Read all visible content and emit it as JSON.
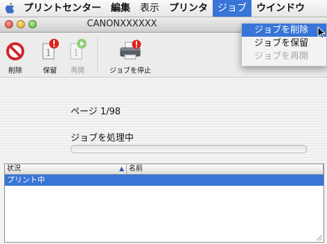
{
  "menubar": {
    "app": "プリントセンター",
    "items": [
      "編集",
      "表示",
      "プリンタ",
      "ジョブ",
      "ウインドウ"
    ],
    "active_index": 3,
    "active_color": "#3875d7"
  },
  "window": {
    "title": "CANONXXXXXX"
  },
  "toolbar": {
    "delete_label": "削除",
    "hold_label": "保留",
    "resume_label": "再開",
    "stop_jobs_label": "ジョブを停止"
  },
  "info": {
    "page_text": "ページ 1/98",
    "status_text": "ジョブを処理中",
    "progress_fraction": 0
  },
  "table": {
    "headers": {
      "status": "状況",
      "name": "名前"
    },
    "rows": [
      {
        "status": "プリント中",
        "name": ""
      }
    ]
  },
  "dropdown": {
    "items": [
      {
        "label": "ジョブを削除",
        "state": "highlighted"
      },
      {
        "label": "ジョブを保留",
        "state": "enabled"
      },
      {
        "label": "ジョブを再開",
        "state": "disabled"
      }
    ]
  },
  "icons": {
    "apple": "apple-logo-icon",
    "delete": "delete-prohibited-icon",
    "hold": "hold-job-icon",
    "resume": "resume-job-icon",
    "stop": "printer-stop-icon",
    "sort": "sort-ascending-icon",
    "resize": "resize-grip-icon",
    "cursor": "mouse-pointer-icon"
  }
}
